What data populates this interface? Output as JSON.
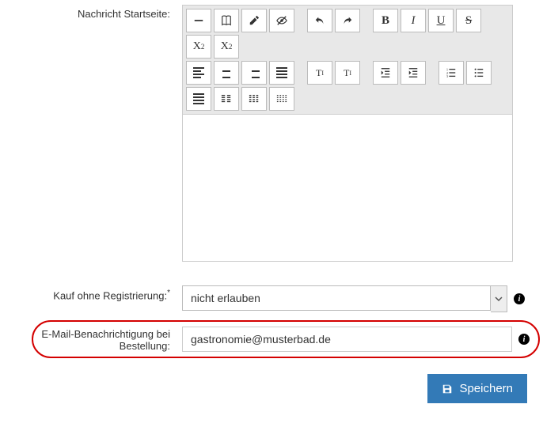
{
  "labels": {
    "message_startpage": "Nachricht Startseite:",
    "purchase_no_reg": "Kauf ohne Registrierung:",
    "email_order_notify_l1": "E-Mail-Benachrichtigung bei",
    "email_order_notify_l2": "Bestellung:"
  },
  "toolbar": {
    "b": "B",
    "i": "I",
    "u": "U",
    "s": "S",
    "sub": "X",
    "sub2": "2",
    "sup": "X",
    "sup2": "2",
    "ti": "TI"
  },
  "fields": {
    "purchase_no_reg_value": "nicht erlauben",
    "email_value": "gastronomie@musterbad.de"
  },
  "buttons": {
    "save": "Speichern"
  }
}
